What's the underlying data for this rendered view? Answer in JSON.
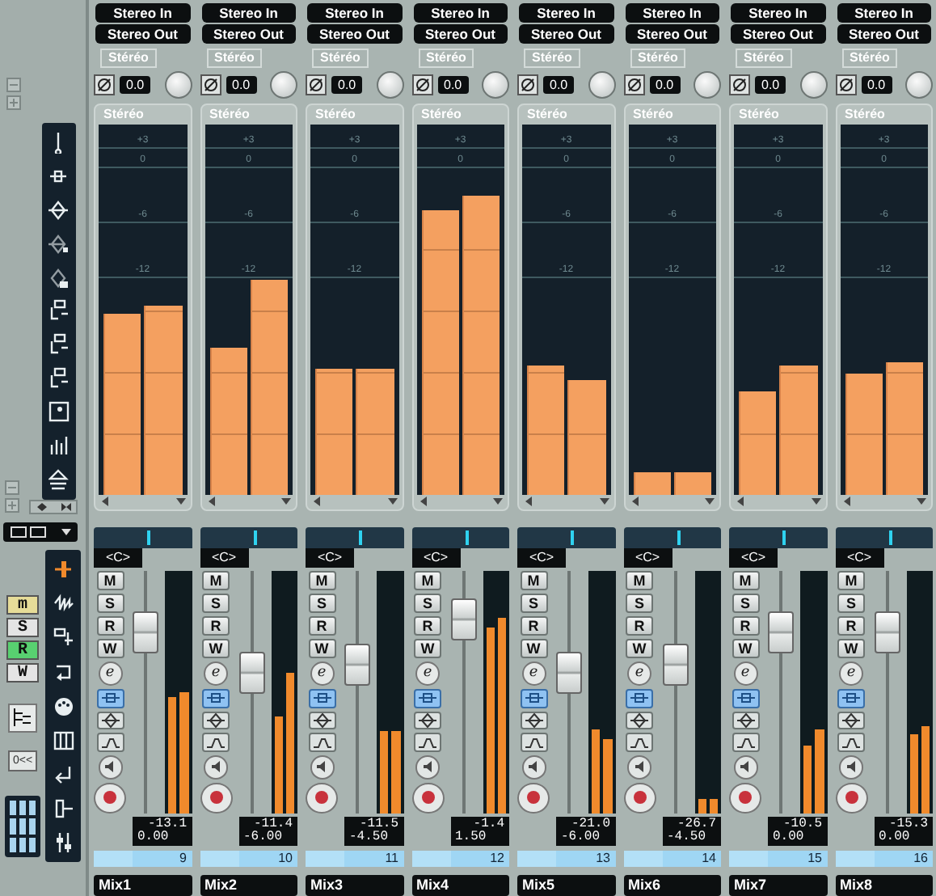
{
  "left_buttons": [
    {
      "label": "m",
      "color": "#e6dc98"
    },
    {
      "label": "S",
      "color": "#e4e4e4"
    },
    {
      "label": "R",
      "color": "#58d070"
    },
    {
      "label": "W",
      "color": "#e4e4e4"
    }
  ],
  "left_text_button": "0<<",
  "channels": [
    {
      "input": "Stereo In",
      "output": "Stereo Out",
      "insert_label": "Stéréo",
      "gain": "0.0",
      "meter_label": "Stéréo",
      "scale": [
        "+3",
        "0",
        "-6",
        "-12"
      ],
      "meters": [
        {
          "level": 0.49
        },
        {
          "level": 0.51
        }
      ],
      "pan_position": {
        "level": 0.55
      },
      "pan": "<C>",
      "buttons": [
        "M",
        "S",
        "R",
        "W",
        "e"
      ],
      "monitor": true,
      "fader": {
        "level": 0.8
      },
      "small_meters": [
        {
          "level": 0.48
        },
        {
          "level": 0.5
        }
      ],
      "peak": "-13.1",
      "volume": "0.00",
      "number": "9",
      "name": "Mix1"
    },
    {
      "input": "Stereo In",
      "output": "Stereo Out",
      "insert_label": "Stéréo",
      "gain": "0.0",
      "meter_label": "Stéréo",
      "scale": [
        "+3",
        "0",
        "-6",
        "-12"
      ],
      "meters": [
        {
          "level": 0.4
        },
        {
          "level": 0.58
        }
      ],
      "pan_position": {
        "level": 0.55
      },
      "pan": "<C>",
      "buttons": [
        "M",
        "S",
        "R",
        "W",
        "e"
      ],
      "monitor": true,
      "fader": {
        "level": 0.6
      },
      "small_meters": [
        {
          "level": 0.4
        },
        {
          "level": 0.58
        }
      ],
      "peak": "-11.4",
      "volume": "-6.00",
      "number": "10",
      "name": "Mix2"
    },
    {
      "input": "Stereo In",
      "output": "Stereo Out",
      "insert_label": "Stéréo",
      "gain": "0.0",
      "meter_label": "Stéréo",
      "scale": [
        "+3",
        "0",
        "-6",
        "-12"
      ],
      "meters": [
        {
          "level": 0.34
        },
        {
          "level": 0.34
        }
      ],
      "pan_position": {
        "level": 0.55
      },
      "pan": "<C>",
      "buttons": [
        "M",
        "S",
        "R",
        "W",
        "e"
      ],
      "monitor": true,
      "fader": {
        "level": 0.64
      },
      "small_meters": [
        {
          "level": 0.34
        },
        {
          "level": 0.34
        }
      ],
      "peak": "-11.5",
      "volume": "-4.50",
      "number": "11",
      "name": "Mix3"
    },
    {
      "input": "Stereo In",
      "output": "Stereo Out",
      "insert_label": "Stéréo",
      "gain": "0.0",
      "meter_label": "Stéréo",
      "scale": [
        "+3",
        "0"
      ],
      "meters": [
        {
          "level": 0.77
        },
        {
          "level": 0.81
        }
      ],
      "pan_position": {
        "level": 0.55
      },
      "pan": "<C>",
      "buttons": [
        "M",
        "S",
        "R",
        "W",
        "e"
      ],
      "monitor": true,
      "fader": {
        "level": 0.86
      },
      "small_meters": [
        {
          "level": 0.77
        },
        {
          "level": 0.81
        }
      ],
      "peak": "-1.4",
      "volume": "1.50",
      "number": "12",
      "name": "Mix4"
    },
    {
      "input": "Stereo In",
      "output": "Stereo Out",
      "insert_label": "Stéréo",
      "gain": "0.0",
      "meter_label": "Stéréo",
      "scale": [
        "+3",
        "0",
        "-6",
        "-12"
      ],
      "meters": [
        {
          "level": 0.35
        },
        {
          "level": 0.31
        }
      ],
      "pan_position": {
        "level": 0.55
      },
      "pan": "<C>",
      "buttons": [
        "M",
        "S",
        "R",
        "W",
        "e"
      ],
      "monitor": true,
      "fader": {
        "level": 0.6
      },
      "small_meters": [
        {
          "level": 0.35
        },
        {
          "level": 0.31
        }
      ],
      "peak": "-21.0",
      "volume": "-6.00",
      "number": "13",
      "name": "Mix5"
    },
    {
      "input": "Stereo In",
      "output": "Stereo Out",
      "insert_label": "Stéréo",
      "gain": "0.0",
      "meter_label": "Stéréo",
      "scale": [
        "+3",
        "0",
        "-6",
        "-12"
      ],
      "meters": [
        {
          "level": 0.06
        },
        {
          "level": 0.06
        }
      ],
      "pan_position": {
        "level": 0.55
      },
      "pan": "<C>",
      "buttons": [
        "M",
        "S",
        "R",
        "W",
        "e"
      ],
      "monitor": true,
      "fader": {
        "level": 0.64
      },
      "small_meters": [
        {
          "level": 0.06
        },
        {
          "level": 0.06
        }
      ],
      "peak": "-26.7",
      "volume": "-4.50",
      "number": "14",
      "name": "Mix6"
    },
    {
      "input": "Stereo In",
      "output": "Stereo Out",
      "insert_label": "Stéréo",
      "gain": "0.0",
      "meter_label": "Stéréo",
      "scale": [
        "+3",
        "0",
        "-6",
        "-12"
      ],
      "meters": [
        {
          "level": 0.28
        },
        {
          "level": 0.35
        }
      ],
      "pan_position": {
        "level": 0.55
      },
      "pan": "<C>",
      "buttons": [
        "M",
        "S",
        "R",
        "W",
        "e"
      ],
      "monitor": true,
      "fader": {
        "level": 0.8
      },
      "small_meters": [
        {
          "level": 0.28
        },
        {
          "level": 0.35
        }
      ],
      "peak": "-10.5",
      "volume": "0.00",
      "number": "15",
      "name": "Mix7"
    },
    {
      "input": "Stereo In",
      "output": "Stereo Out",
      "insert_label": "Stéréo",
      "gain": "0.0",
      "meter_label": "Stéréo",
      "scale": [
        "+3",
        "0",
        "-6",
        "-12"
      ],
      "meters": [
        {
          "level": 0.33
        },
        {
          "level": 0.36
        }
      ],
      "pan_position": {
        "level": 0.55
      },
      "pan": "<C>",
      "buttons": [
        "M",
        "S",
        "R",
        "W",
        "e"
      ],
      "monitor": true,
      "fader": {
        "level": 0.8
      },
      "small_meters": [
        {
          "level": 0.33
        },
        {
          "level": 0.36
        }
      ],
      "peak": "-15.3",
      "volume": "0.00",
      "number": "16",
      "name": "Mix8"
    }
  ]
}
